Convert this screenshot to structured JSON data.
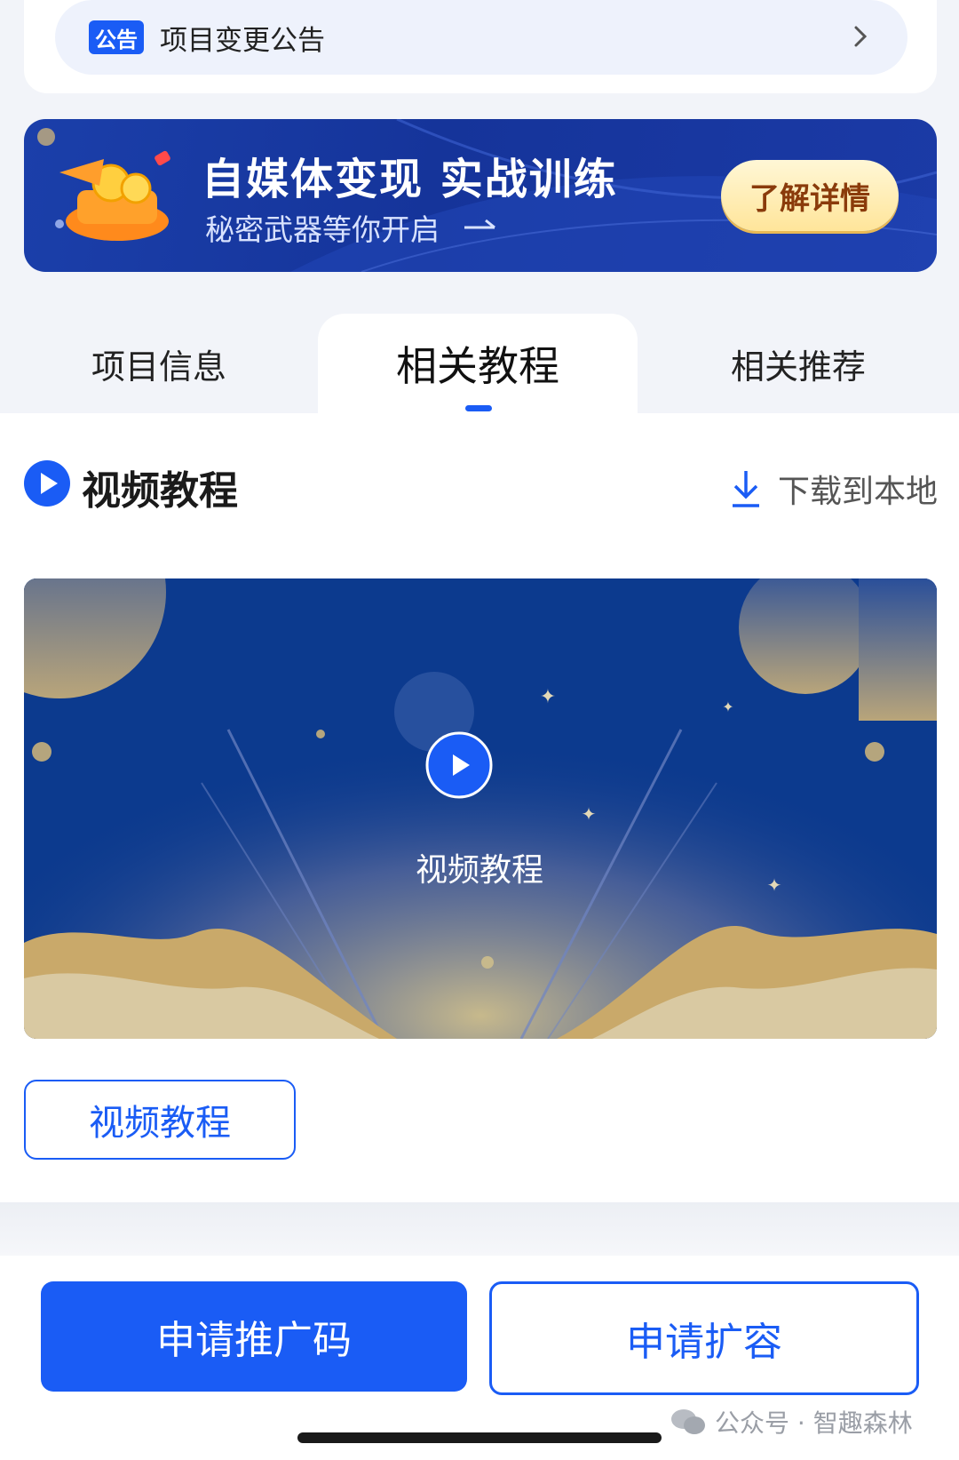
{
  "notice": {
    "tag": "公告",
    "text": "项目变更公告"
  },
  "banner": {
    "title": "自媒体变现 实战训练",
    "subtitle": "秘密武器等你开启",
    "button": "了解详情"
  },
  "tabs": [
    {
      "label": "项目信息",
      "active": false
    },
    {
      "label": "相关教程",
      "active": true
    },
    {
      "label": "相关推荐",
      "active": false
    }
  ],
  "section": {
    "title": "视频教程",
    "download_label": "下载到本地"
  },
  "video": {
    "caption": "视频教程",
    "button_label": "视频教程"
  },
  "bottom": {
    "primary_label": "申请推广码",
    "secondary_label": "申请扩容"
  },
  "watermark": {
    "text": "公众号 · 智趣森林"
  },
  "colors": {
    "accent": "#1a5cf5",
    "banner_bg": "#15349a",
    "video_bg": "#0c3a8e"
  }
}
